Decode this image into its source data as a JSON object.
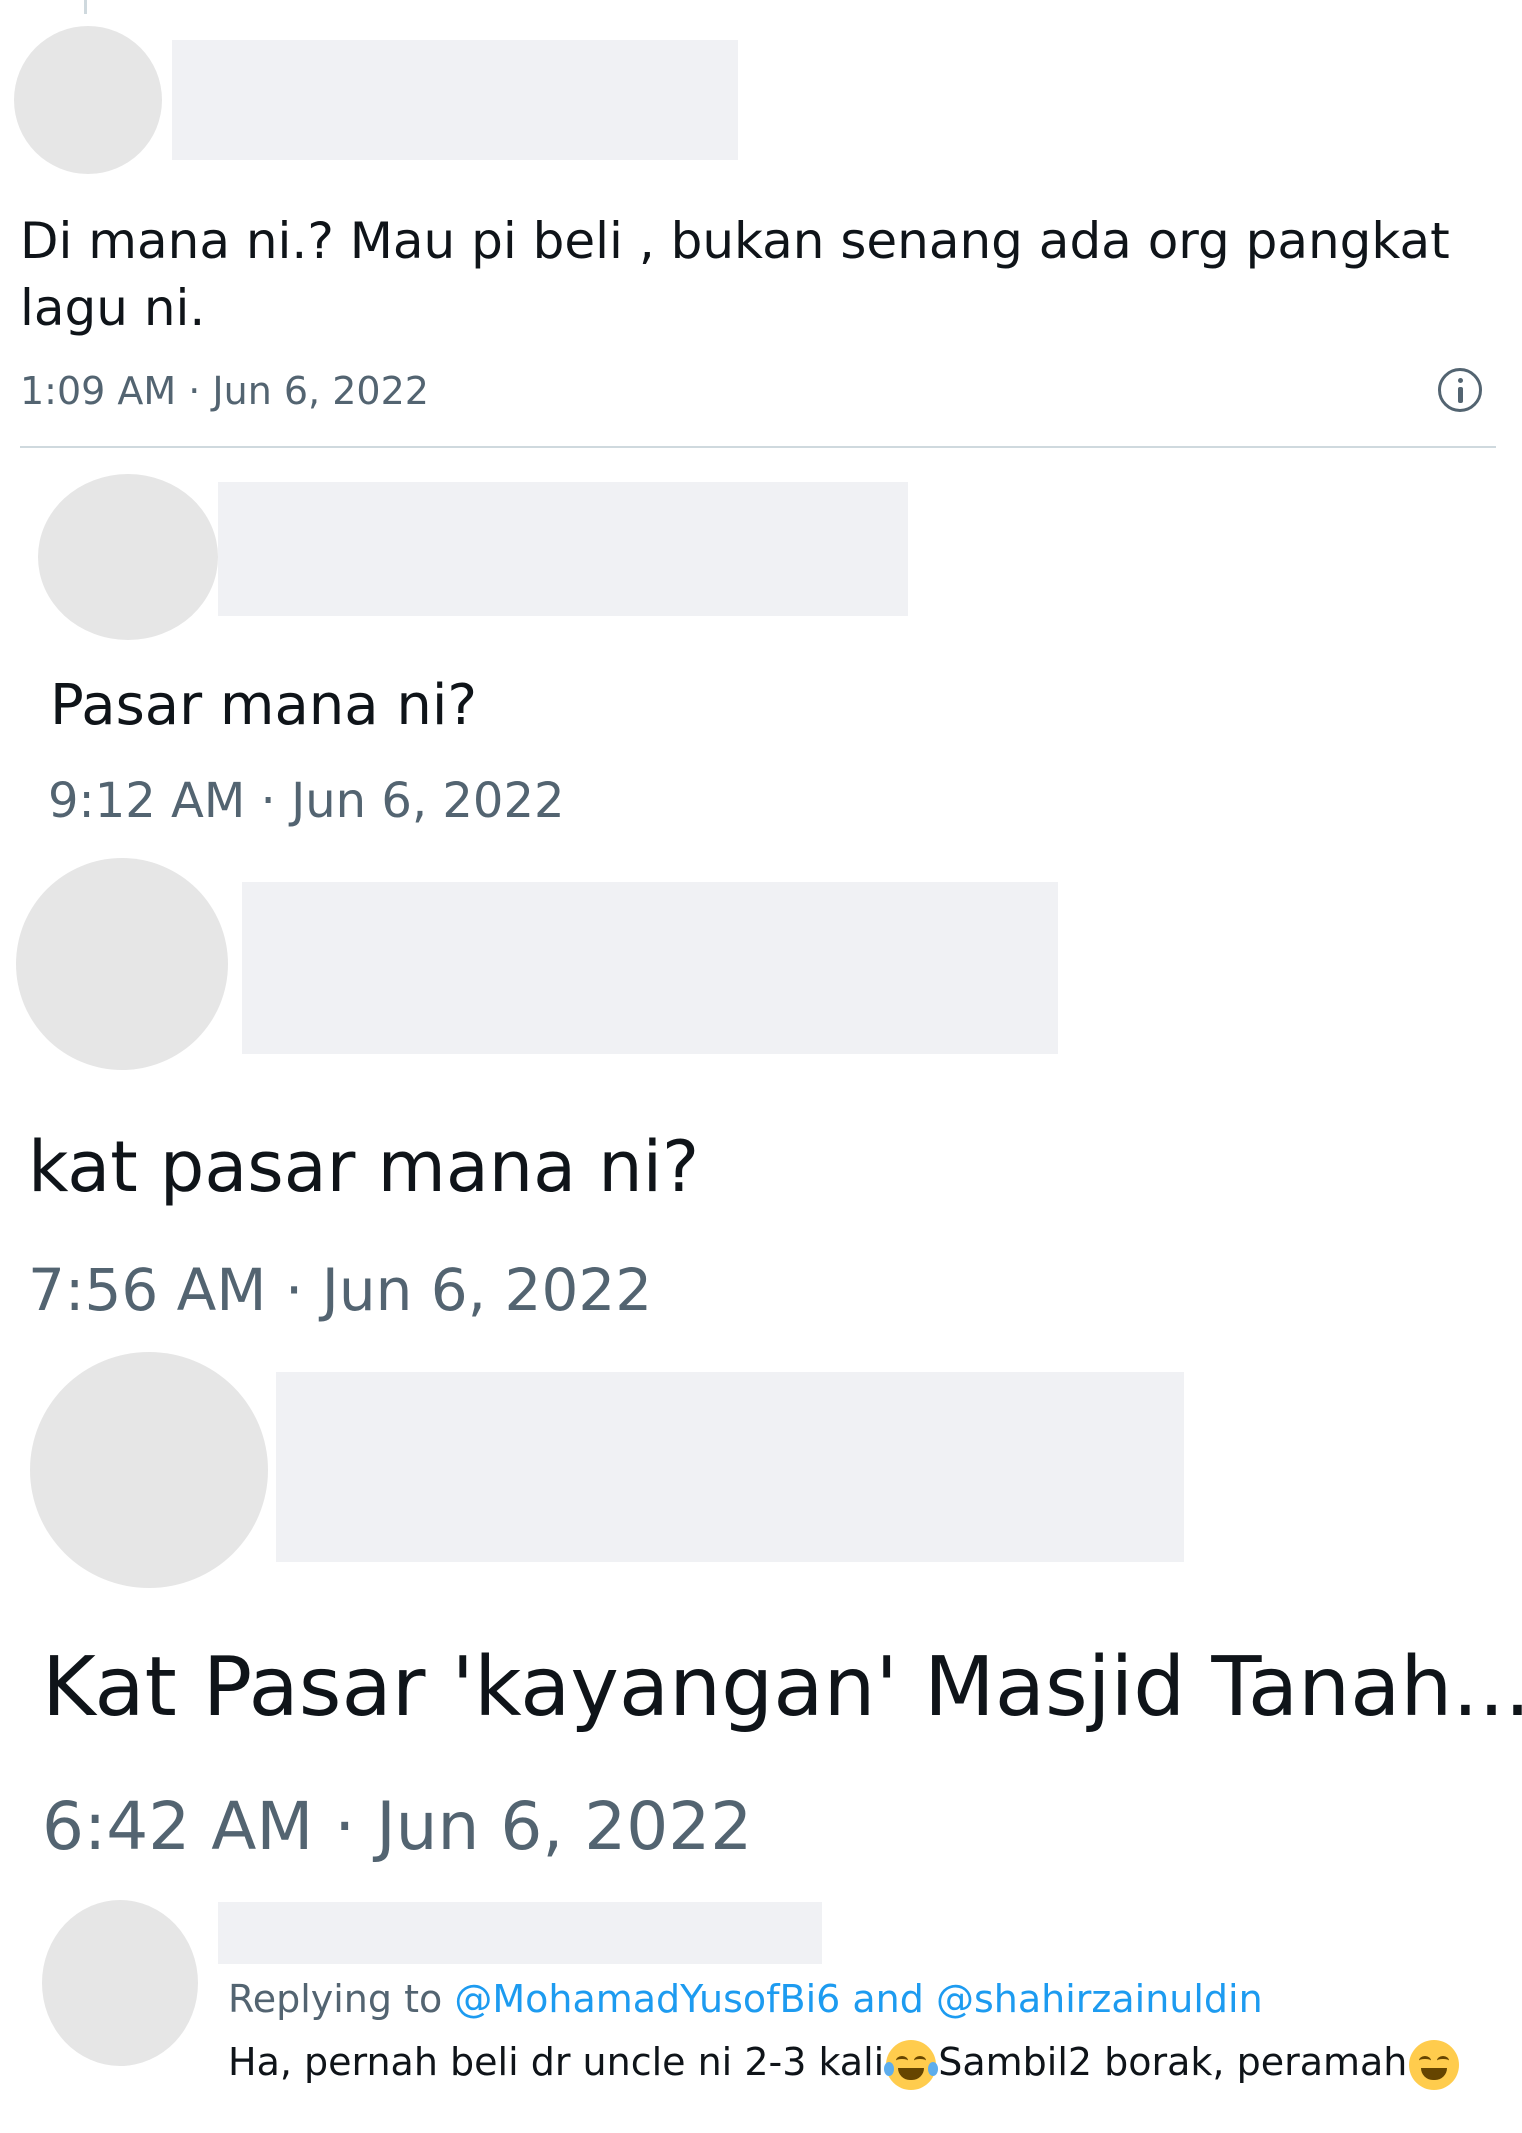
{
  "tweets": [
    {
      "text_line1": "Di mana ni.?  Mau pi beli , bukan senang ada org pangkat",
      "text_line2": "lagu ni.",
      "time": "1:09 AM · Jun 6, 2022"
    },
    {
      "text": "Pasar mana ni?",
      "time": "9:12 AM · Jun 6, 2022"
    },
    {
      "text": "kat pasar mana ni?",
      "time": "7:56 AM · Jun 6, 2022"
    },
    {
      "text": "Kat Pasar 'kayangan' Masjid Tanah...",
      "time": "6:42 AM · Jun 6, 2022"
    },
    {
      "replying_prefix": "Replying to",
      "replying_to": "@MohamadYusofBi6 and @shahirzainuldin",
      "text_part1": "Ha, pernah beli dr uncle ni 2-3 kali",
      "text_part2": "Sambil2 borak, peramah"
    }
  ],
  "icons": {
    "info": "info-icon",
    "emoji_1": "face-with-tears-of-joy-icon",
    "emoji_2": "grinning-squinting-face-icon"
  },
  "colors": {
    "text": "#0f1419",
    "secondary": "#536471",
    "link": "#1d9bf0",
    "placeholder": "#e6e6e6"
  }
}
